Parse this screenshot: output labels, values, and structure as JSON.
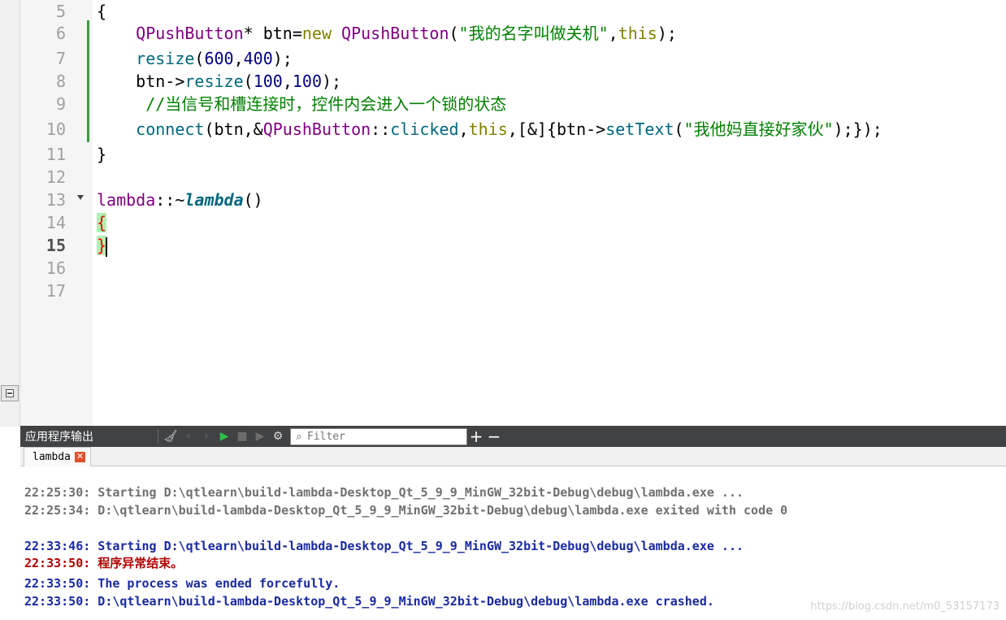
{
  "editor": {
    "line_numbers": [
      "5",
      "6",
      "7",
      "8",
      "9",
      "10",
      "11",
      "12",
      "13",
      "14",
      "15",
      "16",
      "17"
    ],
    "current_line": "15",
    "lines": {
      "l5_open": "{",
      "l6_class": "QPushButton",
      "l6_mid": "* btn=",
      "l6_new": "new",
      "l6_class2": "QPushButton",
      "l6_paren": "(",
      "l6_string": "\"我的名字叫做关机\"",
      "l6_comma": ",",
      "l6_this": "this",
      "l6_end": ");",
      "l7_method": "resize",
      "l7_open": "(",
      "l7_n1": "600",
      "l7_comma": ",",
      "l7_n2": "400",
      "l7_end": ");",
      "l8_obj": "btn->",
      "l8_method": "resize",
      "l8_open": "(",
      "l8_n1": "100",
      "l8_comma": ",",
      "l8_n2": "100",
      "l8_end": ");",
      "l9_comment": "//当信号和槽连接时，控件内会进入一个锁的状态",
      "l10_method": "connect",
      "l10_a": "(btn,&",
      "l10_class": "QPushButton",
      "l10_b": "::",
      "l10_clicked": "clicked",
      "l10_c": ",",
      "l10_this": "this",
      "l10_d": ",[&]{btn->",
      "l10_settext": "setText",
      "l10_e": "(",
      "l10_string": "\"我他妈直接好家伙\"",
      "l10_end": ");});",
      "l11_close": "}",
      "l13_ns": "lambda",
      "l13_sep": "::~",
      "l13_dtor": "lambda",
      "l13_parens": "()",
      "l14_open": "{",
      "l15_close": "}"
    }
  },
  "output_pane": {
    "title": "应用程序输出",
    "filter_placeholder": "Filter",
    "tab_label": "lambda",
    "lines": [
      "22:25:30: Starting D:\\qtlearn\\build-lambda-Desktop_Qt_5_9_9_MinGW_32bit-Debug\\debug\\lambda.exe ...",
      "22:25:34: D:\\qtlearn\\build-lambda-Desktop_Qt_5_9_9_MinGW_32bit-Debug\\debug\\lambda.exe exited with code 0",
      "22:33:46: Starting D:\\qtlearn\\build-lambda-Desktop_Qt_5_9_9_MinGW_32bit-Debug\\debug\\lambda.exe ...",
      "22:33:50: 程序异常结束。",
      "22:33:50: The process was ended forcefully.",
      "22:33:50: D:\\qtlearn\\build-lambda-Desktop_Qt_5_9_9_MinGW_32bit-Debug\\debug\\lambda.exe crashed."
    ],
    "toolbar_icons": [
      "clear-icon",
      "prev-icon",
      "next-icon",
      "run-icon",
      "stop-icon",
      "attach-debugger-icon",
      "settings-icon",
      "search-icon",
      "zoom-in-icon",
      "zoom-out-icon"
    ]
  },
  "watermark": "https://blog.csdn.net/m0_53157173",
  "colors": {
    "class": "#800080",
    "keyword": "#808000",
    "method": "#00677c",
    "number": "#000080",
    "string": "#008000",
    "output_blue": "#1a2aa0",
    "output_red": "#b00000",
    "output_gray": "#707070"
  }
}
